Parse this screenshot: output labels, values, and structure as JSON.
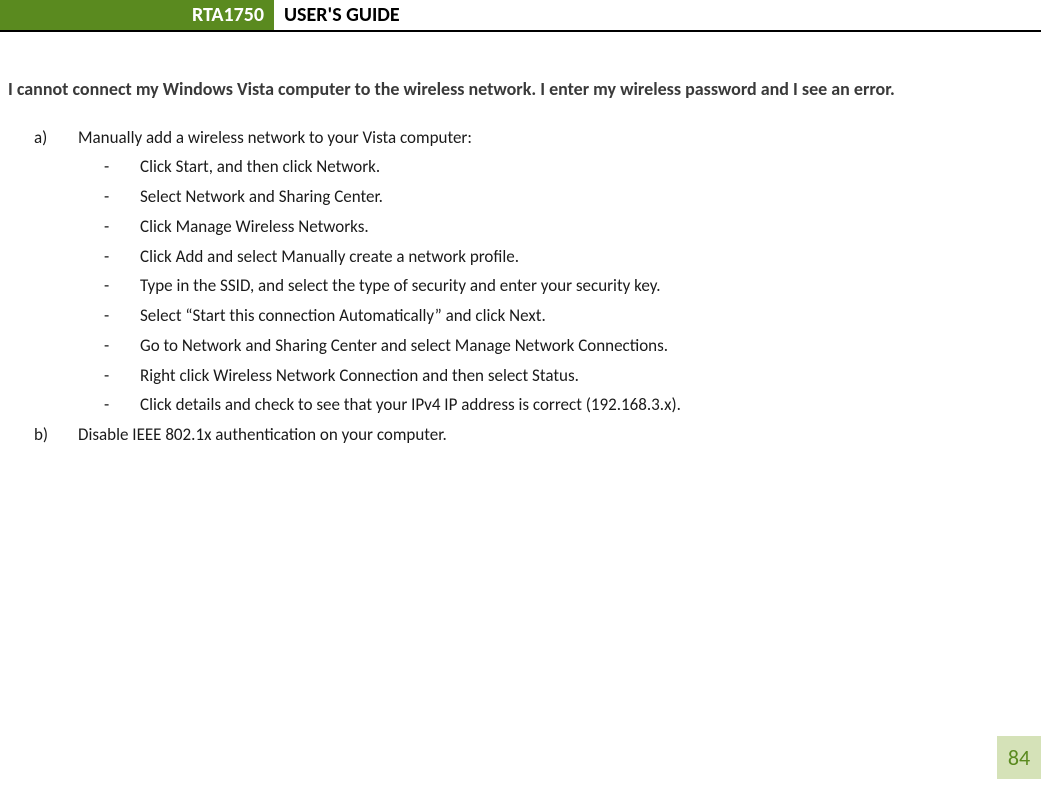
{
  "header": {
    "model": "RTA1750",
    "title": "USER'S GUIDE"
  },
  "issue": "I cannot connect my Windows Vista computer to the wireless network.  I enter my wireless password and I see an error.",
  "items": [
    {
      "marker": "a)",
      "text": "Manually add a wireless network to your Vista computer:",
      "subitems": [
        "Click Start, and then click Network.",
        "Select Network and Sharing Center.",
        "Click Manage Wireless Networks.",
        "Click Add and select Manually create a network profile.",
        "Type in the SSID, and select the type of security and enter your security key.",
        "Select “Start this connection Automatically” and click Next.",
        "Go to Network and Sharing Center and select Manage Network Connections.",
        "Right click Wireless Network Connection and then select Status.",
        "Click details and check to see that your IPv4 IP address is correct (192.168.3.x)."
      ]
    },
    {
      "marker": "b)",
      "text": "Disable IEEE 802.1x authentication on your computer.",
      "subitems": []
    }
  ],
  "page_number": "84"
}
